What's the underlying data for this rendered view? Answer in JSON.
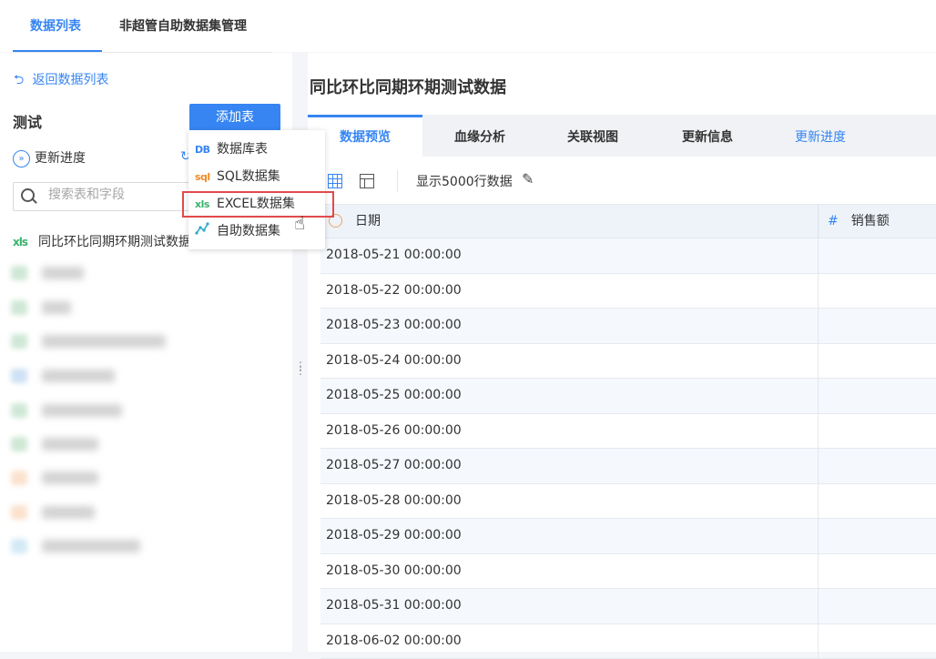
{
  "top_tabs": [
    {
      "label": "数据列表",
      "active": true
    },
    {
      "label": "非超管自助数据集管理",
      "active": false
    }
  ],
  "left": {
    "back_label": "返回数据列表",
    "package_title": "测试",
    "add_table_button": "添加表",
    "update_progress": "更新进度",
    "search_placeholder": "搜索表和字段",
    "table_item": "同比环比同期环期测试数据",
    "table_item_icon": "xls"
  },
  "dropdown": {
    "items": [
      {
        "icon": "DB",
        "label": "数据库表"
      },
      {
        "icon": "sql",
        "label": "SQL数据集"
      },
      {
        "icon": "xls",
        "label": "EXCEL数据集",
        "highlighted": true
      },
      {
        "icon": "self-service-icon",
        "label": "自助数据集"
      }
    ]
  },
  "right": {
    "title": "同比环比同期环期测试数据",
    "tabs": [
      {
        "label": "数据预览",
        "active": true
      },
      {
        "label": "血缘分析",
        "active": false
      },
      {
        "label": "关联视图",
        "active": false
      },
      {
        "label": "更新信息",
        "active": false
      },
      {
        "label": "更新进度",
        "active": false
      }
    ],
    "show_rows": "显示5000行数据",
    "columns": [
      "日期",
      "销售额"
    ],
    "rows": [
      "2018-05-21 00:00:00",
      "2018-05-22 00:00:00",
      "2018-05-23 00:00:00",
      "2018-05-24 00:00:00",
      "2018-05-25 00:00:00",
      "2018-05-26 00:00:00",
      "2018-05-27 00:00:00",
      "2018-05-28 00:00:00",
      "2018-05-29 00:00:00",
      "2018-05-30 00:00:00",
      "2018-05-31 00:00:00",
      "2018-06-02 00:00:00"
    ]
  },
  "colors": {
    "accent": "#3685f2",
    "highlight": "#e2494b",
    "excel_green": "#3bb36a",
    "sql_orange": "#f08a24"
  }
}
